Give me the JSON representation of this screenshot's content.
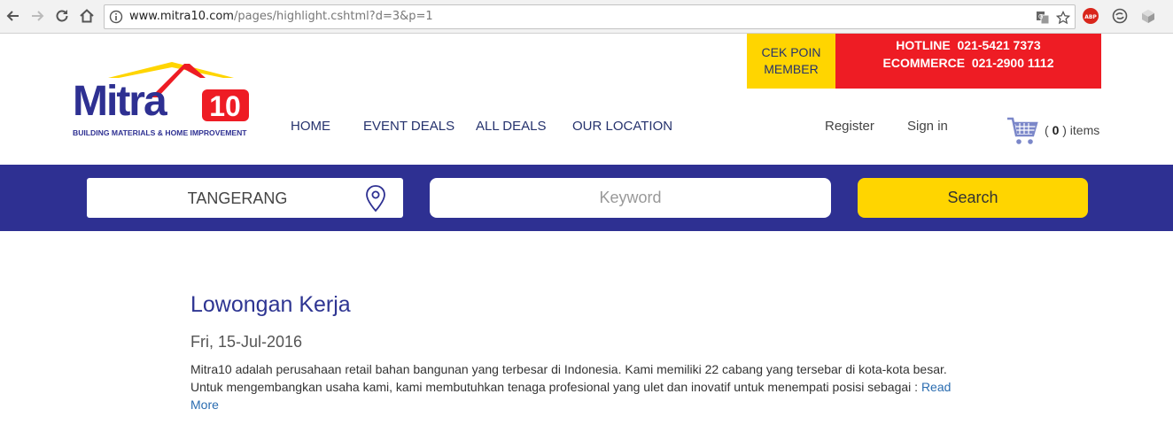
{
  "browser": {
    "url_host": "www.mitra10.com",
    "url_path": "/pages/highlight.cshtml?d=3&p=1",
    "extensions": {
      "abp_label": "ABP"
    }
  },
  "header": {
    "logo": {
      "wordmark": "Mitra",
      "wordmark_num": "10",
      "tagline": "BUILDING MATERIALS & HOME IMPROVEMENT"
    },
    "nav": [
      {
        "label": "HOME"
      },
      {
        "label": "EVENT DEALS"
      },
      {
        "label": "ALL DEALS"
      },
      {
        "label": "OUR LOCATION"
      }
    ],
    "register": "Register",
    "sign_in": "Sign in",
    "cart": {
      "open": "(",
      "count": "0",
      "close": ") items"
    },
    "cek_poin": {
      "line1": "CEK POIN",
      "line2": "MEMBER"
    },
    "hotline": {
      "line1": "HOTLINE  021-5421 7373",
      "line2": "ECOMMERCE  021-2900 1112"
    }
  },
  "search": {
    "location": "TANGERANG",
    "keyword_placeholder": "Keyword",
    "button": "Search"
  },
  "article": {
    "title": "Lowongan Kerja",
    "date": "Fri, 15-Jul-2016",
    "body": "Mitra10 adalah perusahaan retail bahan bangunan yang terbesar di Indonesia. Kami memiliki 22 cabang yang tersebar di kota-kota besar. Untuk mengembangkan usaha kami, kami membutuhkan tenaga profesional yang ulet dan inovatif untuk menempati posisi sebagai : ",
    "read_more": "Read More"
  },
  "colors": {
    "brand_blue": "#2e3092",
    "brand_red": "#ee1c24",
    "brand_yellow": "#ffd500"
  }
}
